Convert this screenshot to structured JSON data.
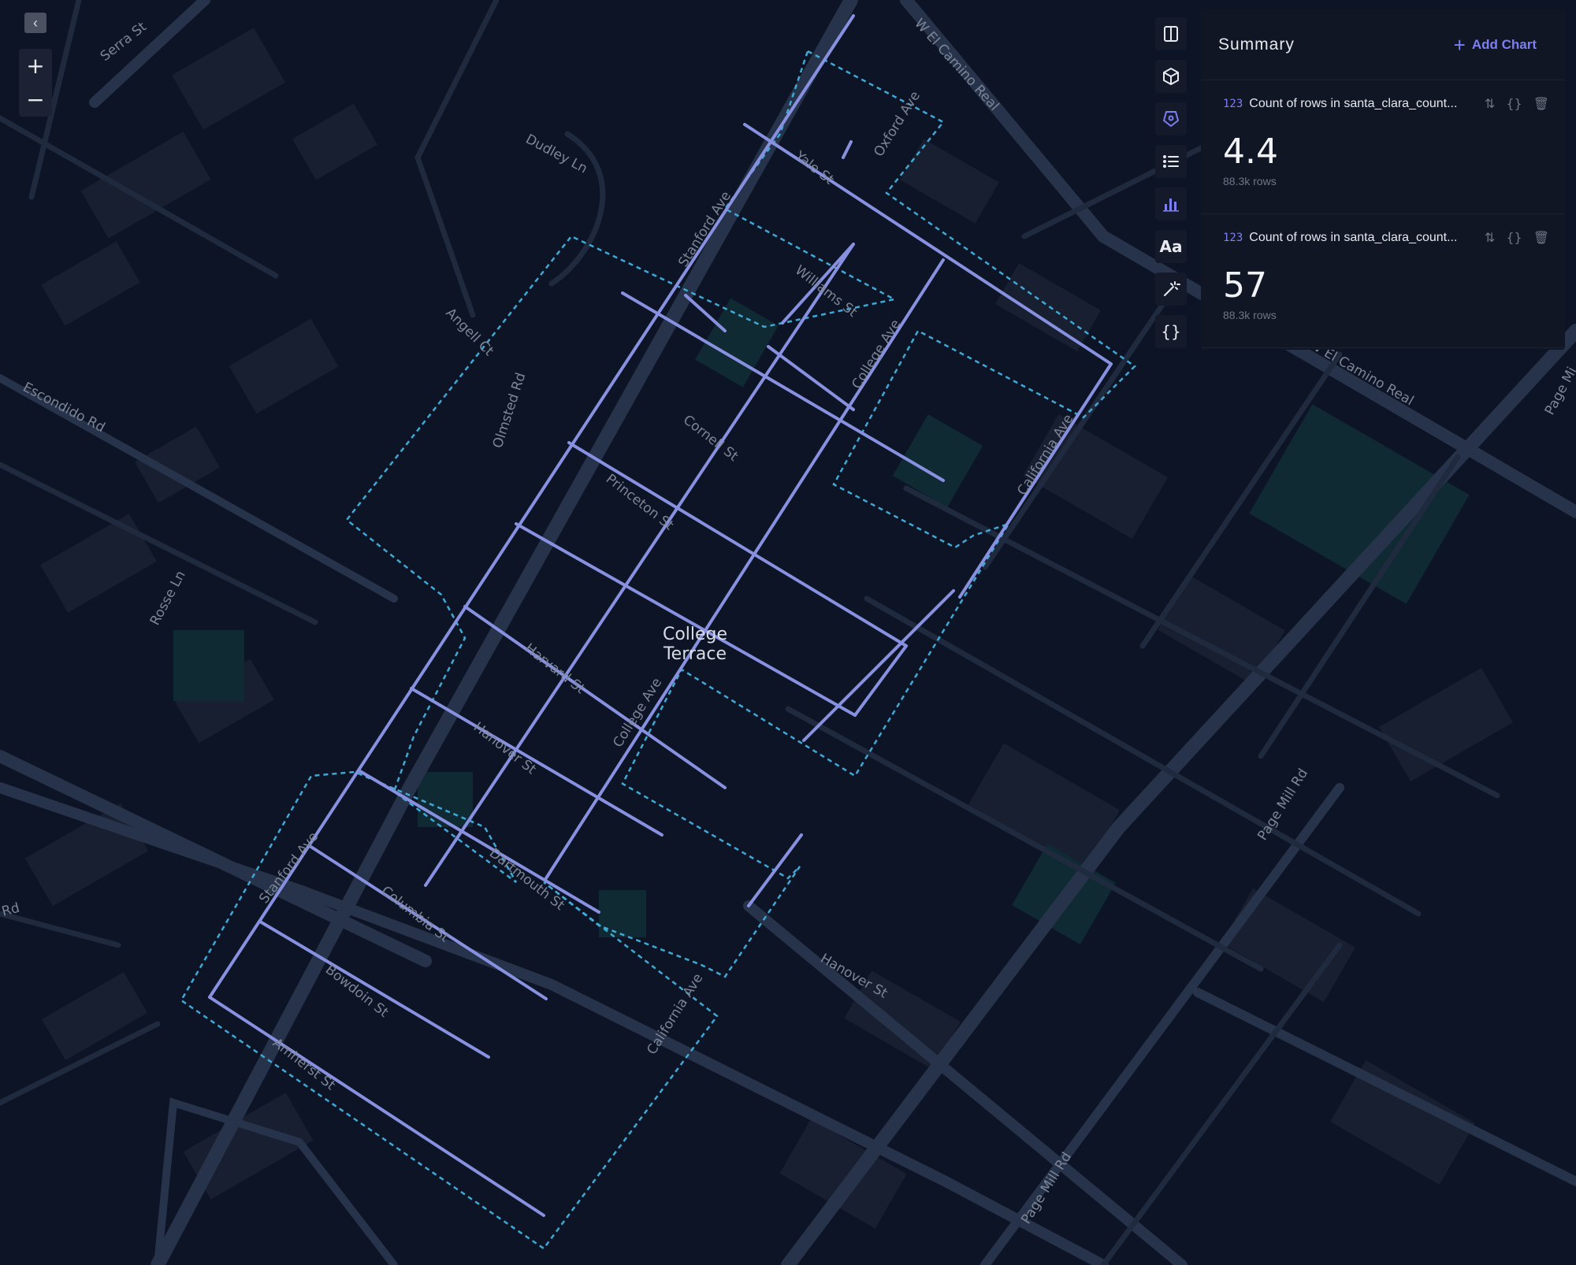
{
  "map": {
    "neighborhood_label": [
      "College",
      "Terrace"
    ],
    "road_labels": {
      "serra": "Serra St",
      "dudley": "Dudley Ln",
      "el_camino_top": "W El Camino Real",
      "el_camino_right": "W El Camino Real",
      "oxford": "Oxford Ave",
      "yale": "Yale St",
      "stanford_top": "Stanford Ave",
      "williams": "Williams St",
      "college_top": "College Ave",
      "angell": "Angell Ct",
      "escondido": "Escondido Rd",
      "olmsted": "Olmsted Rd",
      "cornell": "Cornell St",
      "california_top": "California Ave",
      "princeton": "Princeton St",
      "rosse": "Rosse Ln",
      "harvard": "Harvard St",
      "college_mid": "College Ave",
      "hanover_mid": "Hanover St",
      "dartmouth": "Dartmouth St",
      "stanford_bottom": "Stanford Ave",
      "columbia": "Columbia St",
      "hanover_right": "Hanover St",
      "bowdoin": "Bowdoin St",
      "california_bottom": "California Ave",
      "amherst": "Amherst St",
      "page_mill_mid": "Page Mill Rd",
      "page_mill_bottom": "Page Mill Rd",
      "page_mi_edge": "Page Mi",
      "rd_edge": "Rd"
    }
  },
  "controls": {
    "collapse_glyph": "‹",
    "zoom_in": "+",
    "zoom_out": "−"
  },
  "toolbar": {
    "text_tool_label": "Aa",
    "code_tool_label": "{}"
  },
  "summary": {
    "title": "Summary",
    "add_chart_label": "Add Chart",
    "cards": [
      {
        "type_badge": "123",
        "title": "Count of rows in santa_clara_count...",
        "value": "4.4",
        "sub": "88.3k rows"
      },
      {
        "type_badge": "123",
        "title": "Count of rows in santa_clara_count...",
        "value": "57",
        "sub": "88.3k rows"
      }
    ]
  },
  "colors": {
    "map_bg": "#0d1426",
    "street": "#8891e0",
    "boundary": "#3fa9d6",
    "accent": "#7b7ff2"
  }
}
